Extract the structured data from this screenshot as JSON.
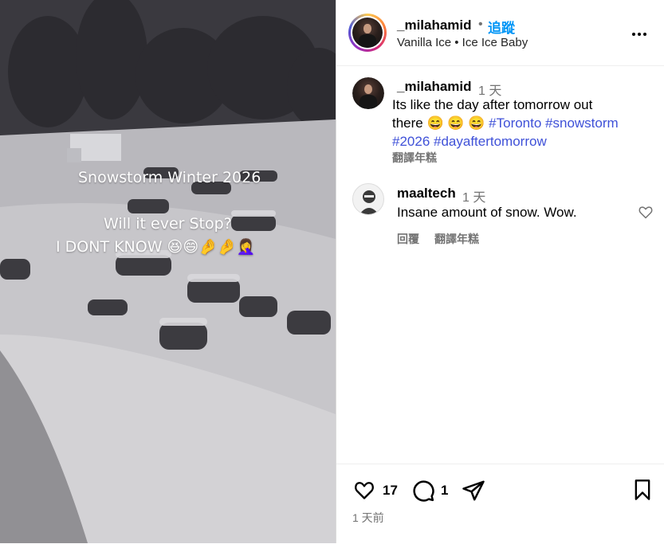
{
  "media": {
    "overlay_title": "Snowstorm Winter 2026",
    "overlay_line2": "Will it ever Stop?",
    "overlay_line3": "I DONT KNOW 😆😄🤌🤌🤦‍♀️"
  },
  "header": {
    "username": "_milahamid",
    "separator": "•",
    "follow_label": "追蹤",
    "audio": "Vanilla Ice • Ice Ice Baby",
    "more_icon": "more-dots-icon"
  },
  "caption": {
    "username": "_milahamid",
    "time": "1 天",
    "text_part1": "Its like the day after tomorrow out",
    "text_part2": "there 😄 😄 😄",
    "hashtags_line1": "#Toronto #snowstorm",
    "hashtags_line2": "#2026 #dayaftertomorrow",
    "translate_label": "翻譯年糕"
  },
  "comments": [
    {
      "username": "maaltech",
      "time": "1 天",
      "text": "Insane amount of snow. Wow.",
      "reply_label": "回覆",
      "translate_label": "翻譯年糕"
    }
  ],
  "footer": {
    "likes": "17",
    "comments_count": "1",
    "posted_ago": "1 天前"
  }
}
